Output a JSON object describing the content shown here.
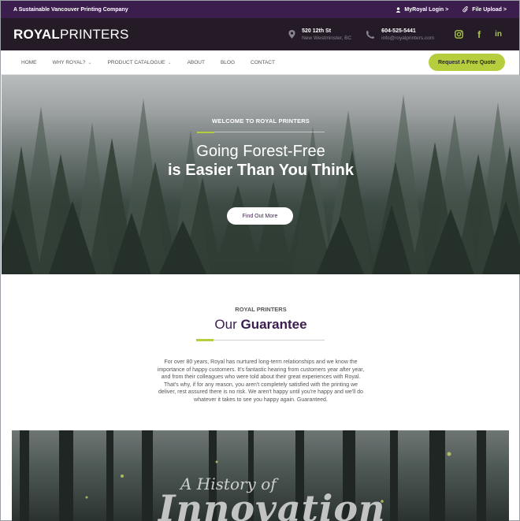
{
  "topbar": {
    "tagline": "A Sustainable Vancouver Printing Company",
    "login": "MyRoyal Login >",
    "upload": "File Upload >"
  },
  "header": {
    "logo_bold": "ROYAL",
    "logo_light": "PRINTERS",
    "address_line1": "520 12th St",
    "address_line2": "New Westminster, BC",
    "phone": "604-525-5441",
    "email": "info@royalprinters.com",
    "socials": [
      "instagram-icon",
      "facebook-icon",
      "linkedin-icon"
    ]
  },
  "nav": {
    "items": [
      "HOME",
      "WHY ROYAL?",
      "PRODUCT CATALOGUE",
      "ABOUT",
      "BLOG",
      "CONTACT"
    ],
    "quote_button": "Request A Free Quote"
  },
  "hero": {
    "eyebrow": "WELCOME TO ROYAL PRINTERS",
    "line1": "Going Forest-Free",
    "line2": "is Easier Than You Think",
    "button": "Find Out More"
  },
  "guarantee": {
    "kicker": "ROYAL PRINTERS",
    "title_a": "Our",
    "title_b": "Guarantee",
    "body": "For over 80 years, Royal has nurtured long-term relationships and we know the importance of happy customers. It's fantastic hearing from customers year after year, and from their colleagues who were told about their great experiences with Royal. That's why, if for any reason, you aren't completely satisfied with the printing we deliver, rest assured there is no risk. We aren't happy until you're happy and we'll do whatever it takes to see you happy again. Guaranteed."
  },
  "history": {
    "script_small": "A History of",
    "script_large": "Innovation"
  },
  "colors": {
    "purple": "#3b1d4e",
    "dark_header": "#241b27",
    "green": "#b6ce3d"
  }
}
